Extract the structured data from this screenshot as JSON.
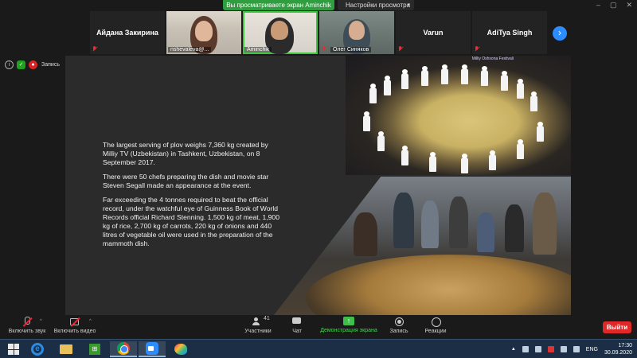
{
  "banner": {
    "share_text": "Вы просматриваете экран Aminchik",
    "view_settings": "Настройки просмотра"
  },
  "participants": [
    {
      "name": "Айдана Закирина",
      "has_video": false,
      "muted": true
    },
    {
      "name": "nshevaleva@...",
      "has_video": true,
      "muted": false
    },
    {
      "name": "Aminchik",
      "has_video": true,
      "muted": false,
      "active": true
    },
    {
      "name": "Олег Синяков",
      "has_video": true,
      "muted": true
    },
    {
      "name": "Varun",
      "has_video": false,
      "muted": true
    },
    {
      "name": "AdiTya Singh",
      "has_video": false,
      "muted": true
    }
  ],
  "status": {
    "record_label": "Запись"
  },
  "slide": {
    "paragraphs": [
      "The largest serving of plov weighs 7,360 kg created by Milliy TV (Uzbekistan) in Tashkent, Uzbekistan, on 8 September 2017.",
      "There were 50 chefs preparing the dish and movie star Steven Segall made an appearance at the event.",
      "Far exceeding the 4 tonnes required to beat the official record, under the watchful eye of Guinness Book of World Records official Richard Stenning. 1,500 kg of meat, 1,900 kg of rice, 2,700 kg of carrots, 220 kg of onions and 440 litres of vegetable oil were used in the preparation of the mammoth dish."
    ],
    "photo_logo": "Milliy Oshxona Festivali"
  },
  "toolbar": {
    "audio_label": "Включить звук",
    "video_label": "Включить видео",
    "participants_label": "Участники",
    "participants_count": "41",
    "chat_label": "Чат",
    "share_label": "Демонстрация экрана",
    "record_label": "Запись",
    "reactions_label": "Реакции",
    "leave_label": "Выйти"
  },
  "taskbar": {
    "language": "ENG",
    "time": "17:30",
    "date": "30.09.2020"
  },
  "colors": {
    "zoom_blue": "#2d8cff",
    "share_green": "#2f9e3f",
    "leave_red": "#e02828",
    "taskbar": "#1b2e46"
  }
}
